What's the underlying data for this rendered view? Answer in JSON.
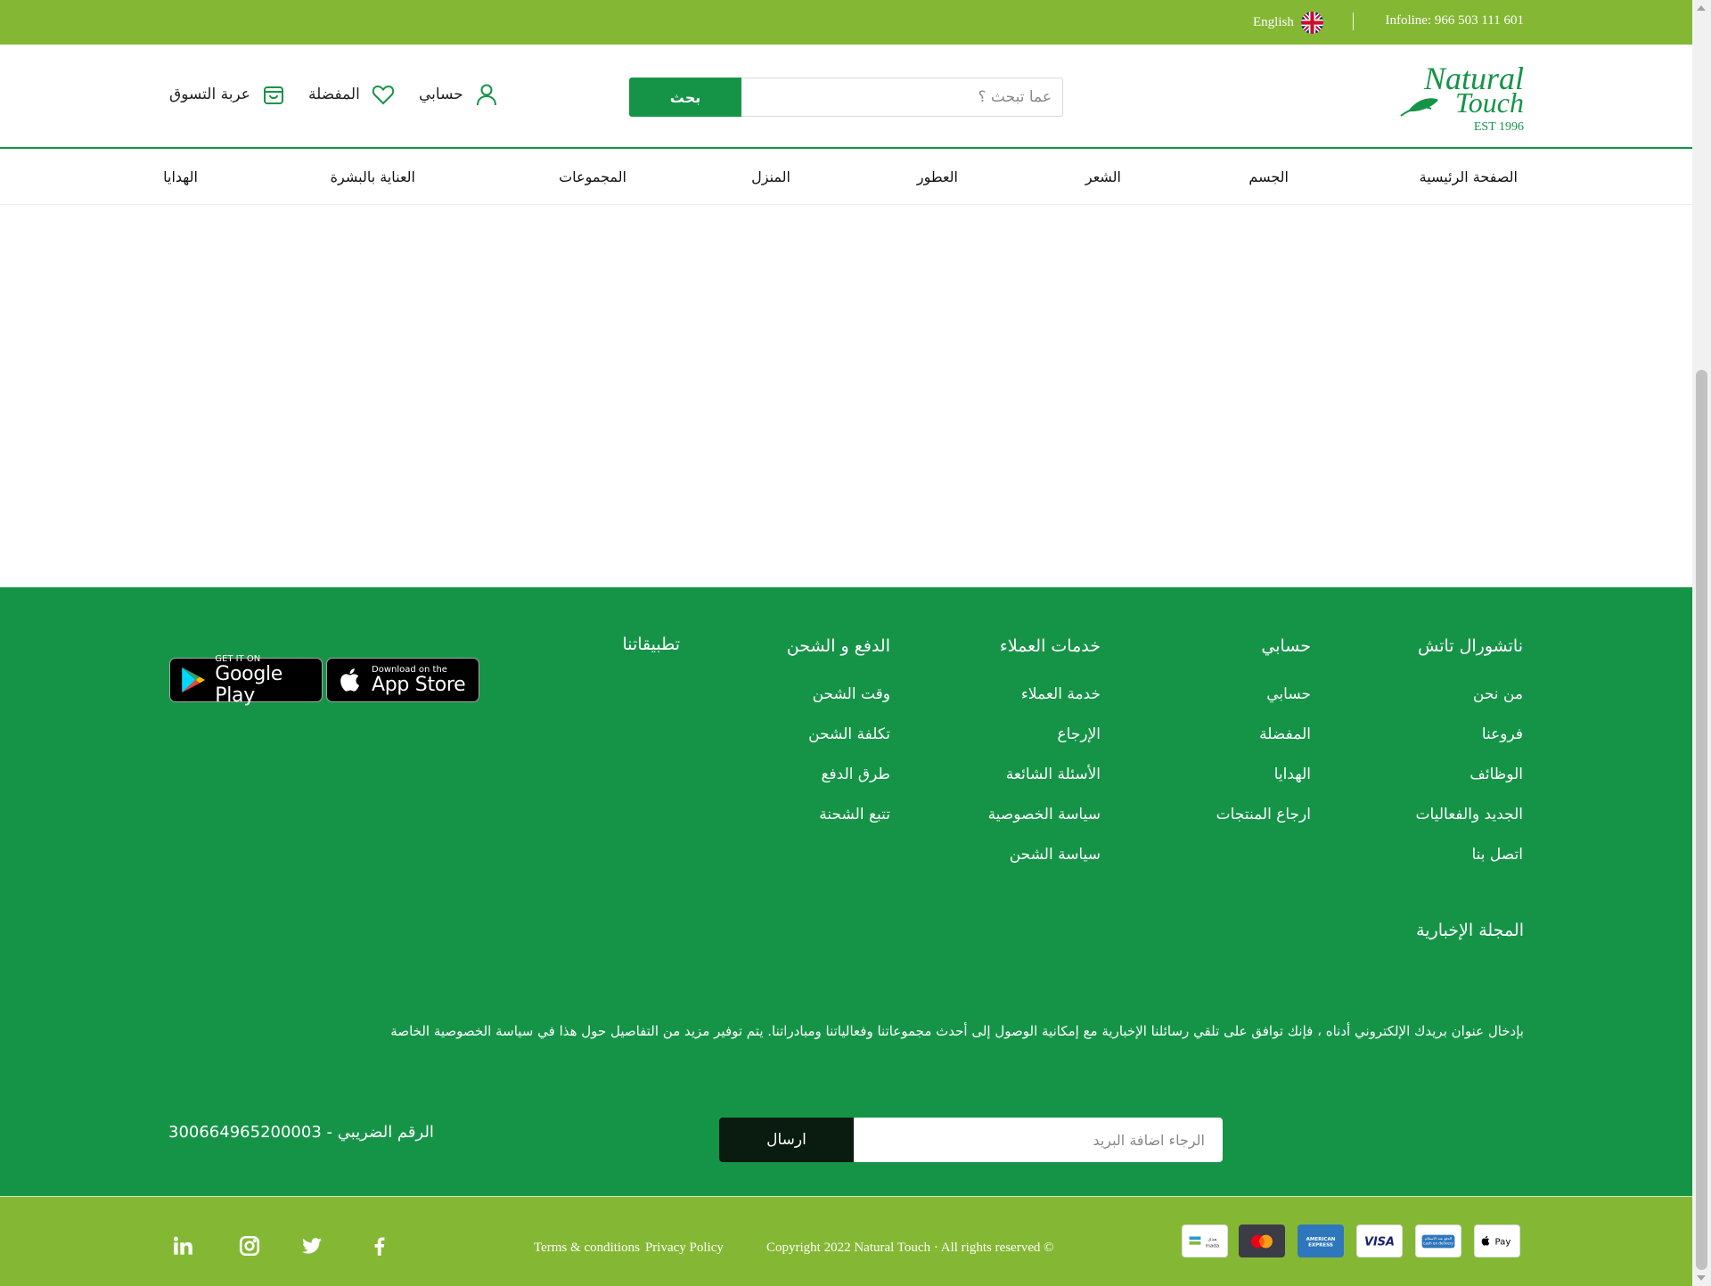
{
  "topbar": {
    "infoline": "Infoline: 966 503 111 601",
    "language": "English"
  },
  "header": {
    "logo": {
      "line1": "Natural",
      "line2": "Touch",
      "est": "EST 1996"
    },
    "search": {
      "placeholder": "عما تبحث ؟",
      "button": "بحث"
    },
    "account": "حسابي",
    "wishlist": "المفضلة",
    "cart": "عربة التسوق"
  },
  "nav": {
    "items": [
      "الصفحة الرئيسية",
      "الجسم",
      "الشعر",
      "العطور",
      "المنزل",
      "المجموعات",
      "العناية بالبشرة",
      "الهدايا"
    ]
  },
  "footer": {
    "columns": [
      {
        "title": "ناتشورال تاتش",
        "links": [
          "من نحن",
          "فروعنا",
          "الوظائف",
          "الجديد والفعاليات",
          "اتصل بنا"
        ]
      },
      {
        "title": "حسابي",
        "links": [
          "حسابي",
          "المفضلة",
          "الهدايا",
          "ارجاع المنتجات"
        ]
      },
      {
        "title": "خدمات العملاء",
        "links": [
          "خدمة العملاء",
          "الإرجاع",
          "الأسئلة الشائعة",
          "سياسة الخصوصية",
          "سياسة الشحن"
        ]
      },
      {
        "title": "الدفع و الشحن",
        "links": [
          "وقت الشحن",
          "تكلفة الشحن",
          "طرق الدفع",
          "تتبع الشحنة"
        ]
      },
      {
        "title": "تطبيقاتنا",
        "links": []
      }
    ],
    "apps": {
      "appstore": {
        "small": "Download on the",
        "big": "App Store"
      },
      "googleplay": {
        "small": "GET IT ON",
        "big": "Google Play"
      }
    },
    "newsletter": {
      "title": "المجلة الإخبارية",
      "text": "بإدخال عنوان بريدك الإلكتروني أدناه ، فإنك توافق على تلقي رسائلنا الإخبارية مع إمكانية الوصول إلى أحدث مجموعاتنا وفعالياتنا ومبادراتنا. يتم توفير مزيد من التفاصيل حول هذا في سياسة الخصوصية الخاصة",
      "placeholder": "الرجاء اضافة البريد",
      "button": "ارسال"
    },
    "tax": "الرقم الضريبي - 300664965200003"
  },
  "bottombar": {
    "copyright": "Copyright 2022 Natural Touch · All rights reserved ©",
    "terms": "Terms & conditions",
    "privacy": "Privacy Policy",
    "social": [
      "linkedin-icon",
      "instagram-icon",
      "twitter-icon",
      "facebook-icon"
    ],
    "payments": [
      "mada",
      "mastercard",
      "AMERICAN EXPRESS",
      "VISA",
      "cash on delivery",
      "Apple Pay"
    ]
  },
  "colors": {
    "brand_green": "#159447",
    "light_green": "#84b834",
    "dark_button": "#0a1b10"
  }
}
